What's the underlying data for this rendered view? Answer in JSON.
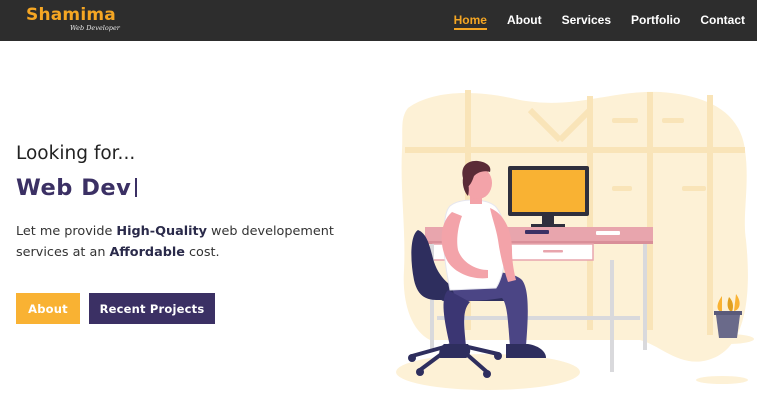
{
  "brand": {
    "name": "Shamima",
    "tagline": "Web Developer"
  },
  "nav": {
    "items": [
      {
        "label": "Home",
        "active": true
      },
      {
        "label": "About",
        "active": false
      },
      {
        "label": "Services",
        "active": false
      },
      {
        "label": "Portfolio",
        "active": false
      },
      {
        "label": "Contact",
        "active": false
      }
    ]
  },
  "hero": {
    "intro": "Looking for...",
    "typed_text": "Web Dev",
    "description": {
      "part1": "Let me provide ",
      "bold1": "High-Quality",
      "part2": " web developement services at an ",
      "bold2": "Affordable",
      "part3": " cost."
    },
    "buttons": {
      "about": "About",
      "projects": "Recent Projects"
    },
    "illustration_icon": "developer-at-desk-illustration"
  },
  "colors": {
    "accent": "#f9b233",
    "primary": "#3b3064",
    "navbar_bg": "#2d2d2d",
    "desk": "#e8a5ad"
  }
}
